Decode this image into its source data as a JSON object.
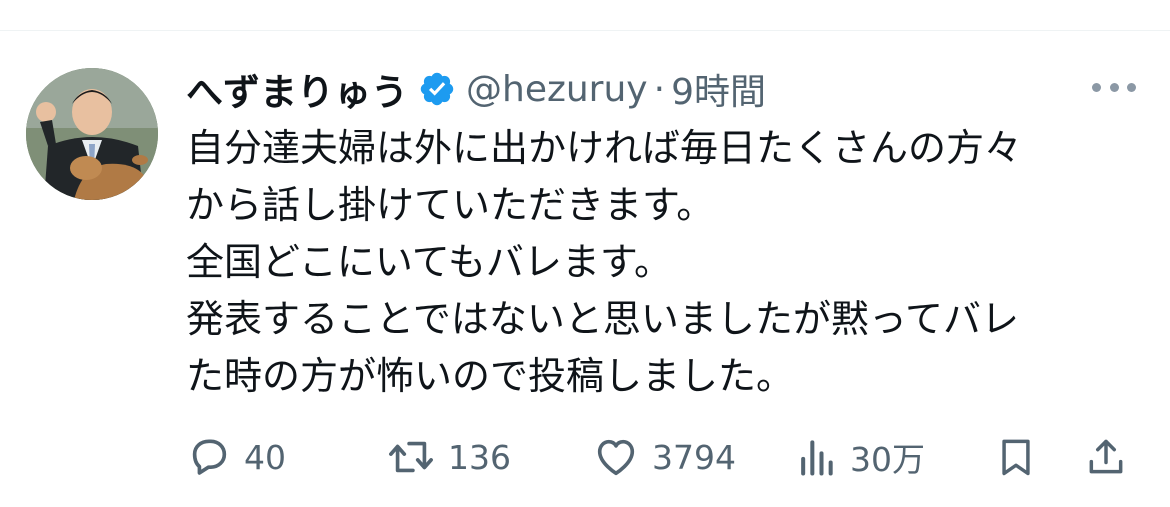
{
  "tweet": {
    "author": {
      "display_name": "へずまりゅう",
      "handle": "@hezuruy",
      "verified": true
    },
    "separator": "·",
    "time": "9時間",
    "text_lines": [
      "自分達夫婦は外に出かければ毎日たくさんの方々",
      "から話し掛けていただきます。",
      "全国どこにいてもバレます。",
      "発表することではないと思いましたが黙ってバレ",
      "た時の方が怖いので投稿しました。"
    ],
    "metrics": {
      "replies": "40",
      "reposts": "136",
      "likes": "3794",
      "views": "30万"
    }
  },
  "icons": {
    "verified": "verified-badge-icon",
    "more": "more-options-icon",
    "reply": "reply-icon",
    "repost": "repost-icon",
    "like": "heart-icon",
    "views": "views-icon",
    "bookmark": "bookmark-icon",
    "share": "share-icon"
  },
  "colors": {
    "text_primary": "#0f1419",
    "text_secondary": "#536471",
    "verified_blue": "#1d9bf0",
    "divider": "#eff3f4"
  }
}
